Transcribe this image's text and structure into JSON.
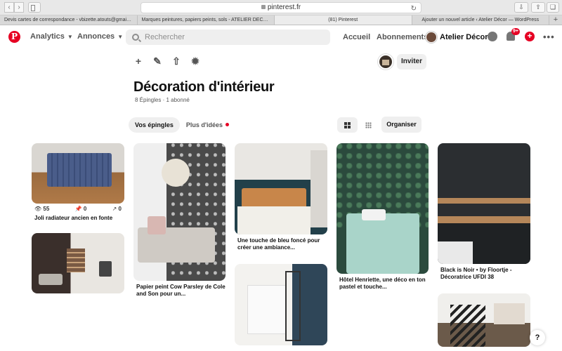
{
  "browser": {
    "url": "pinterest.fr",
    "tabs": [
      "Devis cartes de correspondance - vbizette.atouts@gmail.c...",
      "Marques peintures, papiers peints, sols - ATELIER DECOR (...",
      "(81) Pinterest",
      "Ajouter un nouvel article ‹ Atelier Décor — WordPress"
    ],
    "active_tab": 2
  },
  "header": {
    "logo": "P",
    "analytics": "Analytics",
    "annonces": "Annonces",
    "search_placeholder": "Rechercher",
    "accueil": "Accueil",
    "abonnements": "Abonnements",
    "profile_name": "Atelier Décor",
    "notif_badge": "9+",
    "more": "•••"
  },
  "board": {
    "title": "Décoration d'intérieur",
    "meta": "8 Épingles · 1 abonné",
    "invite": "Inviter",
    "tab_pins": "Vos épingles",
    "tab_ideas": "Plus d'idées",
    "organise": "Organiser"
  },
  "pins": [
    {
      "title": "Joli radiateur ancien en fonte",
      "views": "55",
      "saves": "0",
      "clicks": "0"
    },
    {
      "title": ""
    },
    {
      "title": "Papier peint Cow Parsley de Cole and Son pour un..."
    },
    {
      "title": "Une touche de bleu foncé pour créer une ambiance..."
    },
    {
      "title": ""
    },
    {
      "title": "Hôtel Henriette, une déco en ton pastel et touche..."
    },
    {
      "title": "Black is Noir • by Floortje - Décoratrice UFDI 38"
    },
    {
      "title": ""
    }
  ],
  "help": "?"
}
